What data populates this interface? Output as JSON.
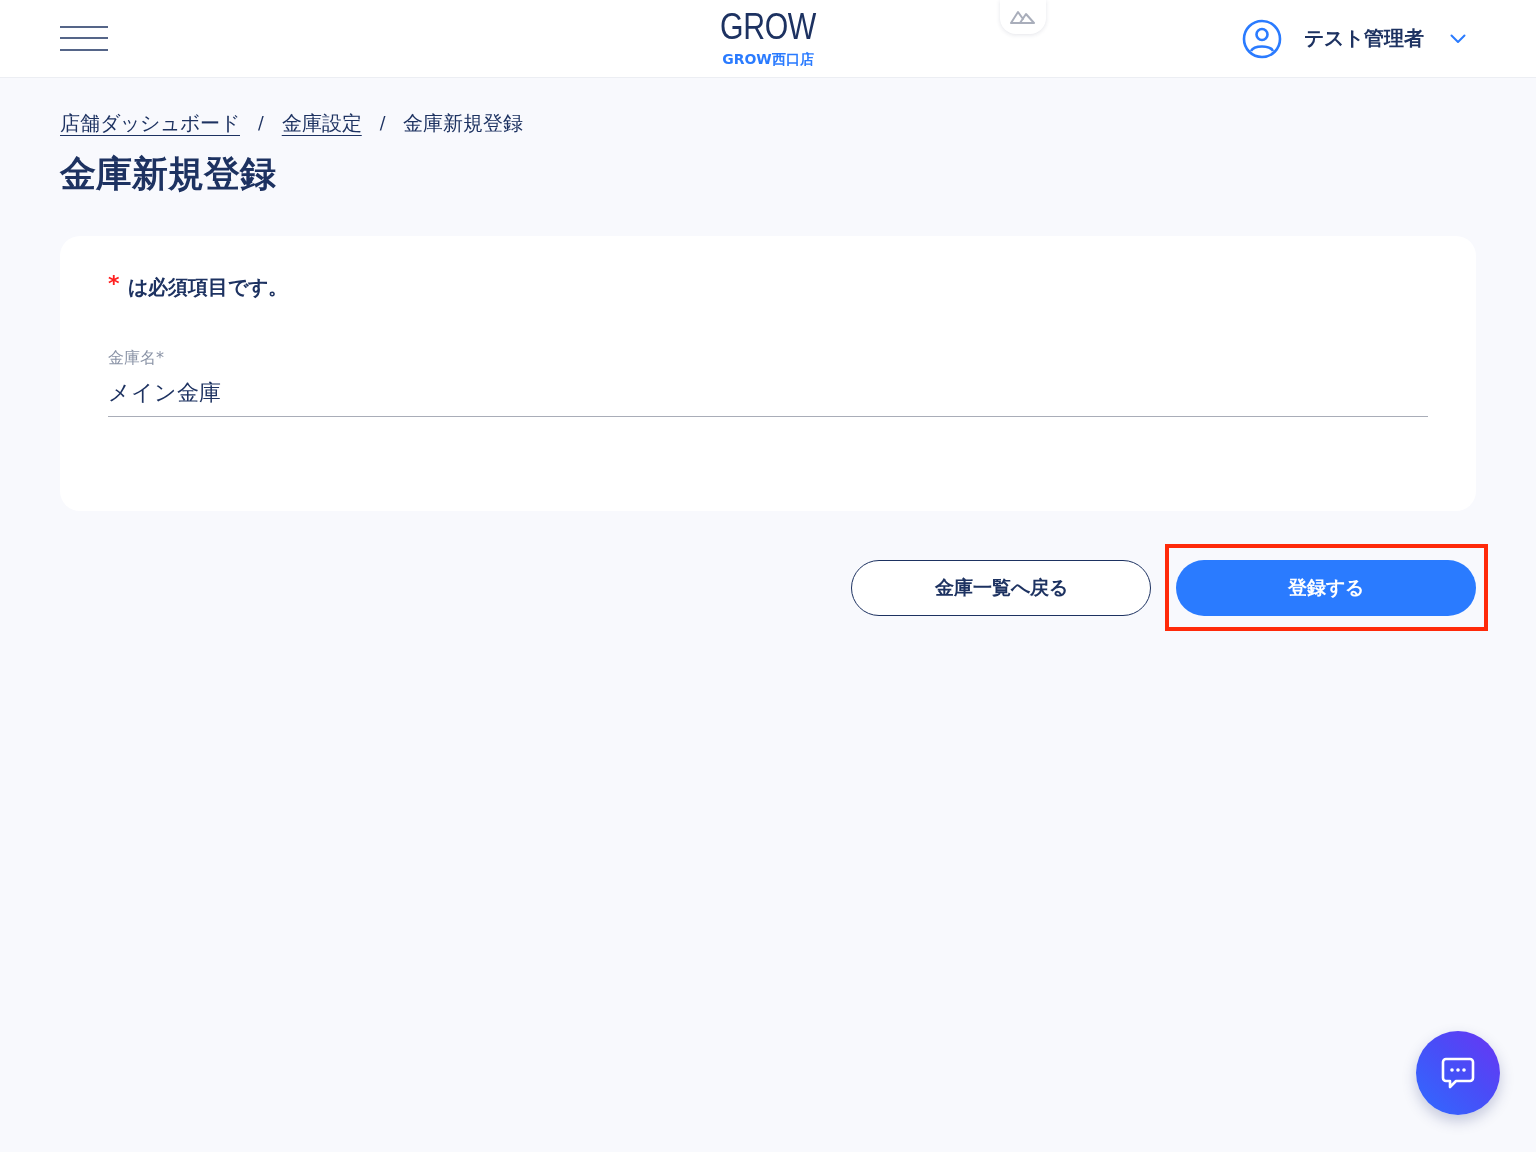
{
  "header": {
    "logo": "GROW",
    "store": "GROW西口店",
    "user": "テスト管理者"
  },
  "breadcrumbs": [
    {
      "label": "店舗ダッシュボード",
      "link": true
    },
    {
      "label": "金庫設定",
      "link": true
    },
    {
      "label": "金庫新規登録",
      "link": false
    }
  ],
  "breadcrumb_separators": [
    "/",
    "/"
  ],
  "page_title": "金庫新規登録",
  "form": {
    "required_note": {
      "mark": "*",
      "text": "は必須項目です。"
    },
    "fields": [
      {
        "label": "金庫名*",
        "value": "メイン金庫"
      }
    ]
  },
  "buttons": [
    {
      "label": "金庫一覧へ戻る",
      "kind": "secondary",
      "highlighted": false
    },
    {
      "label": "登録する",
      "kind": "primary",
      "highlighted": true
    }
  ]
}
